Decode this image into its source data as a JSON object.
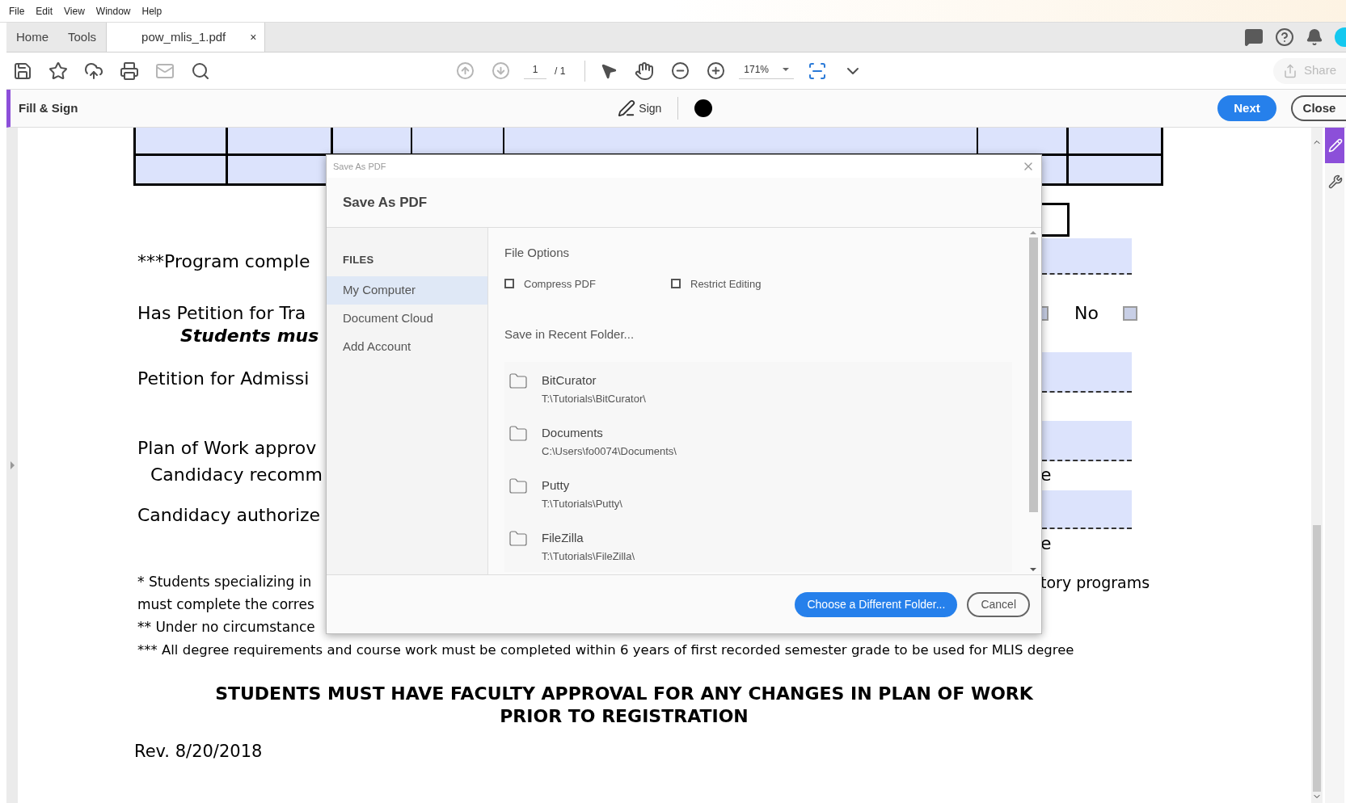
{
  "menu": [
    "File",
    "Edit",
    "View",
    "Window",
    "Help"
  ],
  "tabs": [
    {
      "label": "Home",
      "selected": false
    },
    {
      "label": "Tools",
      "selected": false
    },
    {
      "label": "pow_mlis_1.pdf",
      "selected": true,
      "close": "×"
    }
  ],
  "toolbar": {
    "page_number": "1",
    "page_total": "/ 1",
    "zoom": "171%",
    "share": {
      "label": "Share",
      "disabled": true
    }
  },
  "fill_sign": {
    "title": "Fill & Sign",
    "sign": "Sign",
    "next": "Next",
    "close": "Close"
  },
  "document": {
    "program_line": "***Program comple",
    "petition_transfer": {
      "left": "Has Petition for Tra",
      "option": "No",
      "checkboxes": [
        {
          "checked": false
        },
        {
          "checked": false
        }
      ]
    },
    "students_line": "Students mus",
    "petition_admission": "Petition for Admissi",
    "plan_line": "Plan of Work approv",
    "candidacy_recommended": {
      "left": "Candidacy recomm",
      "right": "e"
    },
    "candidacy_authorized": {
      "left": "Candidacy authorize",
      "right": "e"
    },
    "footnotes": [
      {
        "left": "* Students specializing in",
        "right": "tory programs"
      },
      {
        "left": "must complete the corres"
      },
      {
        "left": "** Under no circumstance"
      },
      {
        "left": "*** All degree requirements and course work must be completed within 6 years of first recorded semester grade to be used for MLIS degree"
      }
    ],
    "notice": [
      "STUDENTS MUST HAVE FACULTY APPROVAL FOR ANY CHANGES IN PLAN OF WORK",
      "PRIOR TO REGISTRATION"
    ],
    "revision": "Rev. 8/20/2018"
  },
  "dialog": {
    "window_title": "Save As PDF",
    "heading": "Save As PDF",
    "sidebar": {
      "section": "FILES",
      "items": [
        {
          "label": "My Computer",
          "selected": true
        },
        {
          "label": "Document Cloud",
          "selected": false
        },
        {
          "label": "Add Account",
          "selected": false
        }
      ]
    },
    "file_options": {
      "title": "File Options",
      "checkboxes": [
        {
          "label": "Compress PDF",
          "checked": false
        },
        {
          "label": "Restrict Editing",
          "checked": false
        }
      ]
    },
    "recent_title": "Save in Recent Folder...",
    "folders": [
      {
        "name": "BitCurator",
        "path": "T:\\Tutorials\\BitCurator\\"
      },
      {
        "name": "Documents",
        "path": "C:\\Users\\fo0074\\Documents\\"
      },
      {
        "name": "Putty",
        "path": "T:\\Tutorials\\Putty\\"
      },
      {
        "name": "FileZilla",
        "path": "T:\\Tutorials\\FileZilla\\"
      }
    ],
    "buttons": [
      {
        "label": "Choose a Different Folder...",
        "kind": "primary"
      },
      {
        "label": "Cancel",
        "kind": "secondary"
      }
    ]
  }
}
